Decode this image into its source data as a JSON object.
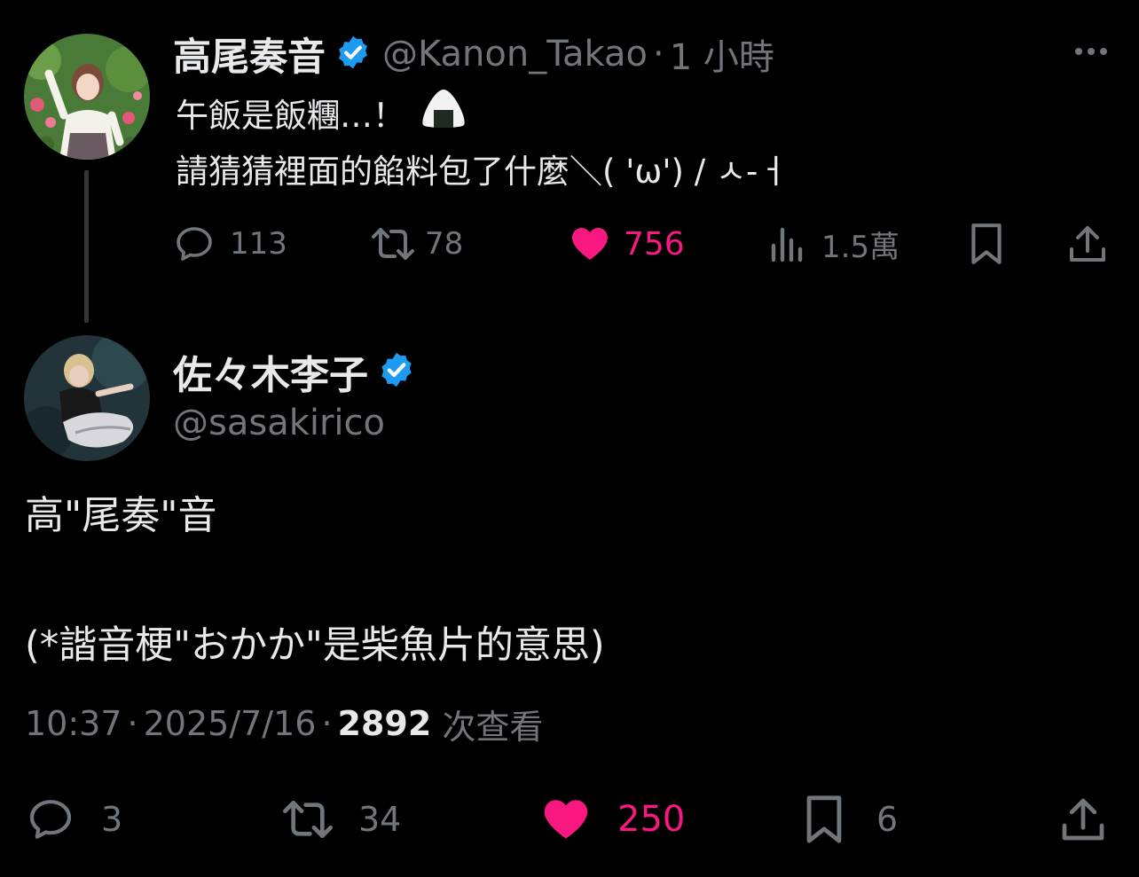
{
  "colors": {
    "background": "#000000",
    "text": "#e7e9ea",
    "muted": "#71767b",
    "like": "#f91880",
    "verified": "#1d9bf0"
  },
  "parent_tweet": {
    "display_name": "高尾奏音",
    "handle": "@Kanon_Takao",
    "separator": "·",
    "time": "1 小時",
    "line1": "午飯是飯糰…！",
    "line1_emoji_icon": "rice-ball-icon",
    "line2": "請猜猜裡面的餡料包了什麼＼( 'ω') / ㅅ-ㅓ",
    "replies": "113",
    "retweets": "78",
    "likes": "756",
    "views": "1.5萬"
  },
  "main_tweet": {
    "display_name": "佐々木李子",
    "handle": "@sasakirico",
    "text_line1": "高\"尾奏\"音",
    "text_line2": "(*諧音梗\"おかか\"是柴魚片的意思)",
    "time": "10:37",
    "dot1": "·",
    "date": "2025/7/16",
    "dot2": "·",
    "views_count": "2892",
    "views_label": "次查看",
    "replies": "3",
    "retweets": "34",
    "likes": "250",
    "bookmarks": "6"
  }
}
